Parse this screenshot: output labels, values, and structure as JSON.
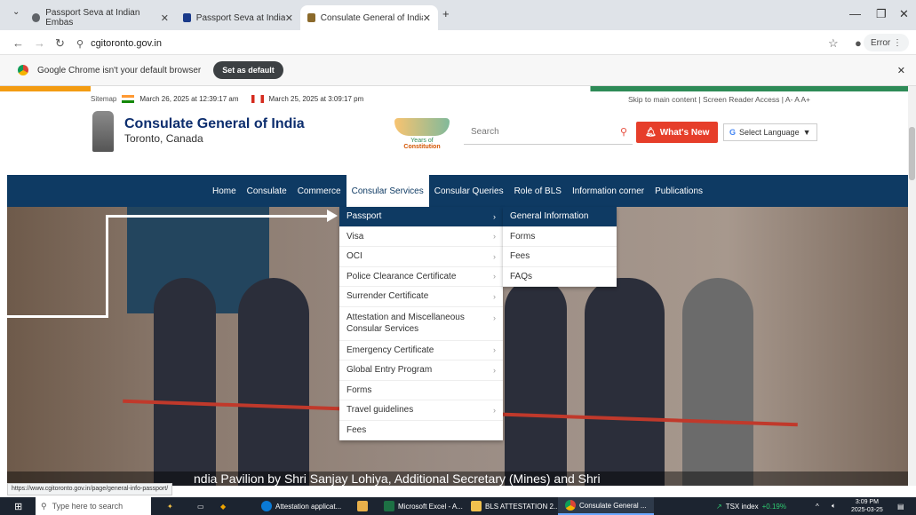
{
  "browser": {
    "tabs": [
      {
        "label": "Passport Seva at Indian Embas"
      },
      {
        "label": "Passport Seva at Indian Embas"
      },
      {
        "label": "Consulate General of India, Toro"
      }
    ],
    "url": "cgitoronto.gov.in",
    "error_label": "Error",
    "infobar_text": "Google Chrome isn't your default browser",
    "set_default_label": "Set as default"
  },
  "header": {
    "sitemap": "Sitemap",
    "date_india": "March 26, 2025 at 12:39:17 am",
    "date_canada": "March 25, 2025 at 3:09:17 pm",
    "skip": "Skip to main content | Screen Reader Access | A- A A+",
    "title": "Consulate General of India",
    "subtitle": "Toronto, Canada",
    "constitution_top": "Years of",
    "constitution": "Constitution",
    "search_placeholder": "Search",
    "whats_new": "What's New",
    "language": "Select Language"
  },
  "nav": [
    {
      "label": "Home"
    },
    {
      "label": "Consulate"
    },
    {
      "label": "Commerce"
    },
    {
      "label": "Consular Services"
    },
    {
      "label": "Consular Queries"
    },
    {
      "label": "Role of BLS"
    },
    {
      "label": "Information corner"
    },
    {
      "label": "Publications"
    }
  ],
  "dropdown": [
    {
      "label": "Passport"
    },
    {
      "label": "Visa"
    },
    {
      "label": "OCI"
    },
    {
      "label": "Police Clearance Certificate"
    },
    {
      "label": "Surrender Certificate"
    },
    {
      "label": "Attestation and Miscellaneous Consular Services"
    },
    {
      "label": "Emergency Certificate"
    },
    {
      "label": "Global Entry Program"
    },
    {
      "label": "Forms"
    },
    {
      "label": "Travel guidelines"
    },
    {
      "label": "Fees"
    }
  ],
  "submenu": [
    {
      "label": "General Information"
    },
    {
      "label": "Forms"
    },
    {
      "label": "Fees"
    },
    {
      "label": "FAQs"
    }
  ],
  "hero_caption": "ndia Pavilion by Shri Sanjay Lohiya, Additional Secretary (Mines) and Shri",
  "status_url": "https://www.cgitoronto.gov.in/page/general-info-passport/",
  "taskbar": {
    "search": "Type here to search",
    "apps": [
      {
        "label": "Attestation applicat..."
      },
      {
        "label": "Microsoft Excel - A..."
      },
      {
        "label": "BLS ATTESTATION 2..."
      },
      {
        "label": "Consulate General ..."
      }
    ],
    "tsx_label": "TSX index",
    "tsx_change": "+0.19%",
    "time": "3:09 PM",
    "date": "2025-03-25"
  }
}
